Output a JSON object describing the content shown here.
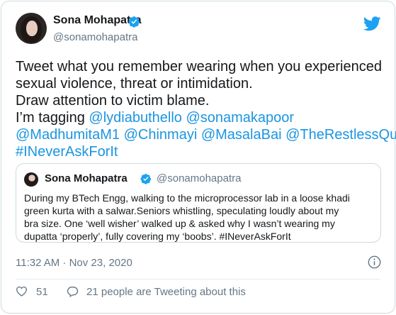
{
  "author": {
    "name": "Sona Mohapatra",
    "handle": "@sonamohapatra",
    "verified_color": "#1da1f2"
  },
  "tweet": {
    "lines": [
      [
        {
          "text": "Tweet what you remember wearing when you experienced",
          "type": "text"
        }
      ],
      [
        {
          "text": "sexual violence, threat or intimidation.",
          "type": "text"
        }
      ],
      [
        {
          "text": "Draw attention to victim blame.",
          "type": "text"
        }
      ],
      [
        {
          "text": "I’m tagging ",
          "type": "text"
        },
        {
          "text": "@lydiabuthello",
          "type": "mention"
        },
        {
          "text": " ",
          "type": "text"
        },
        {
          "text": "@sonamakapoor",
          "type": "mention"
        }
      ],
      [
        {
          "text": "@MadhumitaM1",
          "type": "mention"
        },
        {
          "text": " ",
          "type": "text"
        },
        {
          "text": "@Chinmayi",
          "type": "mention"
        },
        {
          "text": " ",
          "type": "text"
        },
        {
          "text": "@MasalaBai",
          "type": "mention"
        },
        {
          "text": " ",
          "type": "text"
        },
        {
          "text": "@TheRestlessQuil",
          "type": "mention"
        }
      ],
      [
        {
          "text": "#INeverAskForIt",
          "type": "mention"
        }
      ]
    ]
  },
  "quoted": {
    "name": "Sona Mohapatra",
    "handle": "@sonamohapatra",
    "lines": [
      "During my BTech Engg, walking to the microprocessor lab in a loose khadi",
      "green kurta with a salwar.Seniors whistling, speculating loudly about my",
      "bra size. One ‘well wisher’  walked up & asked why I wasn’t wearing my",
      "dupatta ‘properly’, fully covering my ‘boobs’. #INeverAskForIt"
    ]
  },
  "timestamp": "11:32 AM · Nov 23, 2020",
  "actions": {
    "likes_count": "51",
    "people_text": "21 people are Tweeting about this"
  },
  "icons": {
    "brand": "twitter-bird-icon",
    "verified": "verified-badge-icon",
    "info": "info-icon",
    "like": "heart-icon",
    "reply": "speech-bubble-icon"
  },
  "colors": {
    "brand": "#1da1f2",
    "mention": "#1b95e0",
    "secondary_text": "#657786",
    "border": "#cfd9de"
  }
}
